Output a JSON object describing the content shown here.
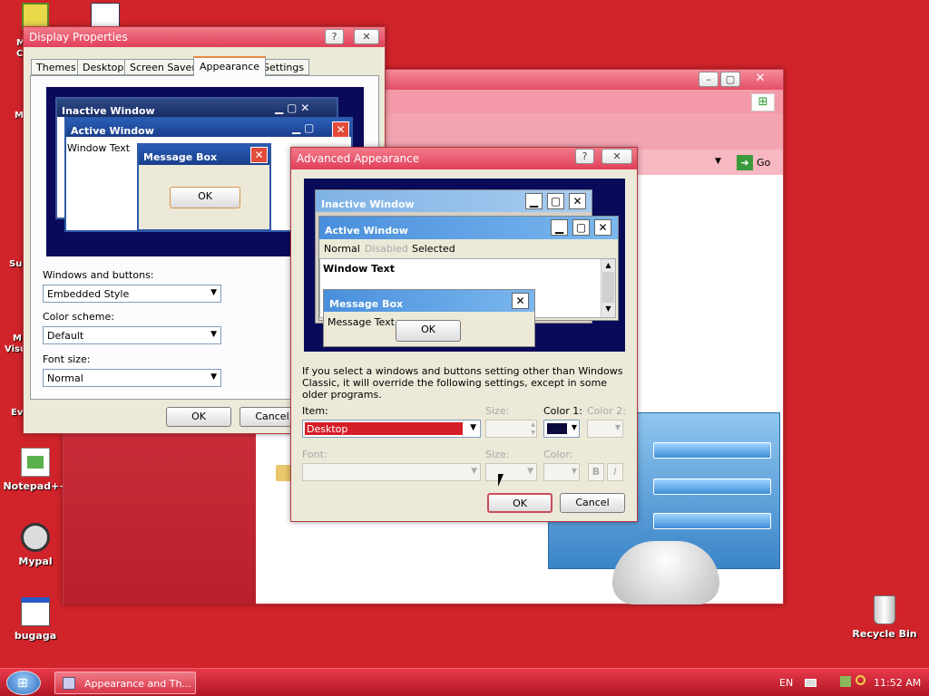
{
  "desktop": {
    "icons": [
      {
        "label": "Notepad++"
      },
      {
        "label": "Mypal"
      },
      {
        "label": "bugaga"
      },
      {
        "label": "Recycle Bin"
      }
    ],
    "cut_labels": [
      "M",
      "C",
      "M",
      "Su",
      "M",
      "Visu",
      "Ev"
    ]
  },
  "display_props": {
    "title": "Display Properties",
    "help": "?",
    "close": "✕",
    "tabs": [
      "Themes",
      "Desktop",
      "Screen Saver",
      "Appearance",
      "Settings"
    ],
    "preview": {
      "inactive": "Inactive Window",
      "active": "Active Window",
      "window_text": "Window Text",
      "msgbox": "Message Box",
      "ok": "OK"
    },
    "windows_buttons_label": "Windows and buttons:",
    "windows_buttons_value": "Embedded Style",
    "color_scheme_label": "Color scheme:",
    "color_scheme_value": "Default",
    "font_size_label": "Font size:",
    "font_size_value": "Normal",
    "ok": "OK",
    "cancel": "Cancel"
  },
  "advanced": {
    "title": "Advanced Appearance",
    "help": "?",
    "close": "✕",
    "preview": {
      "inactive": "Inactive Window",
      "active": "Active Window",
      "menu_normal": "Normal",
      "menu_disabled": "Disabled",
      "menu_selected": "Selected",
      "window_text": "Window Text",
      "msgbox": "Message Box",
      "msg_text": "Message Text",
      "ok": "OK"
    },
    "info": "If you select a windows and buttons setting other than Windows Classic, it will override the following settings, except in some older programs.",
    "item_label": "Item:",
    "item_value": "Desktop",
    "size_label": "Size:",
    "color1_label": "Color 1:",
    "color2_label": "Color 2:",
    "font_label": "Font:",
    "size2_label": "Size:",
    "color_label": "Color:",
    "bold": "B",
    "italic": "I",
    "ok": "OK",
    "cancel": "Cancel"
  },
  "bg_window": {
    "go": "Go"
  },
  "taskbar": {
    "task_label": "Appearance and Th...",
    "lang": "EN",
    "clock": "11:52 AM"
  },
  "colors": {
    "desktop": "#d1232a",
    "preview_navy": "#0a0a5a",
    "item_red": "#d51e28",
    "color1_swatch": "#0a0a3c"
  }
}
